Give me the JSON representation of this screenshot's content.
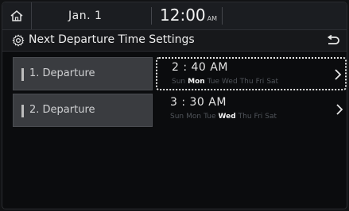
{
  "status_bar": {
    "date": "Jan.  1",
    "time": "12:00",
    "ampm": "AM"
  },
  "header": {
    "title": "Next Departure Time Settings"
  },
  "departures": [
    {
      "label": "1. Departure",
      "time": "2 : 40 AM",
      "days": [
        "Sun",
        "Mon",
        "Tue",
        "Wed",
        "Thu",
        "Fri",
        "Sat"
      ],
      "active_days": [
        "Mon"
      ],
      "selected": true
    },
    {
      "label": "2. Departure",
      "time": "3 : 30 AM",
      "days": [
        "Sun",
        "Mon",
        "Tue",
        "Wed",
        "Thu",
        "Fri",
        "Sat"
      ],
      "active_days": [
        "Wed"
      ],
      "selected": false
    }
  ],
  "icons": {
    "home": "home-icon",
    "settings": "settings-gear-icon",
    "back": "back-arrow-icon",
    "chevron": "chevron-right-icon"
  },
  "colors": {
    "background": "#0b0c0e",
    "row_label_bg": "#3a3c40",
    "active_day": "#f2f2f2",
    "inactive_day": "#50545a"
  }
}
